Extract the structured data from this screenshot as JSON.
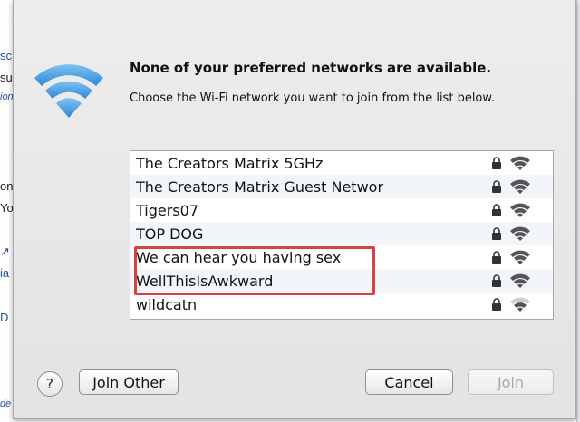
{
  "background_page": {
    "fragments": [
      "sc",
      "su",
      "ion",
      "on",
      "Yo",
      "↗",
      "ia",
      "D",
      "de"
    ]
  },
  "dialog": {
    "headline": "None of your preferred networks are available.",
    "subline": "Choose the Wi-Fi network you want to join from the list below.",
    "icon": "wifi-icon",
    "networks": [
      {
        "name": "The Creators Matrix 5GHz",
        "secured": true,
        "signal": 3
      },
      {
        "name": "The Creators Matrix Guest Networ",
        "secured": true,
        "signal": 3
      },
      {
        "name": "Tigers07",
        "secured": true,
        "signal": 3
      },
      {
        "name": "TOP DOG",
        "secured": true,
        "signal": 3
      },
      {
        "name": "We can hear you having sex",
        "secured": true,
        "signal": 3
      },
      {
        "name": "WellThisIsAwkward",
        "secured": true,
        "signal": 3
      },
      {
        "name": "wildcatn",
        "secured": true,
        "signal": 2
      }
    ],
    "highlighted_rows": [
      "We can hear you having sex",
      "WellThisIsAwkward"
    ],
    "highlight_color": "#d9413f",
    "buttons": {
      "help": "?",
      "join_other": "Join Other",
      "cancel": "Cancel",
      "join": "Join"
    }
  },
  "colors": {
    "wifi_blue": "#4aa3e8",
    "dialog_bg": "#e8e8e8",
    "list_alt_row": "#f2f5fa"
  }
}
